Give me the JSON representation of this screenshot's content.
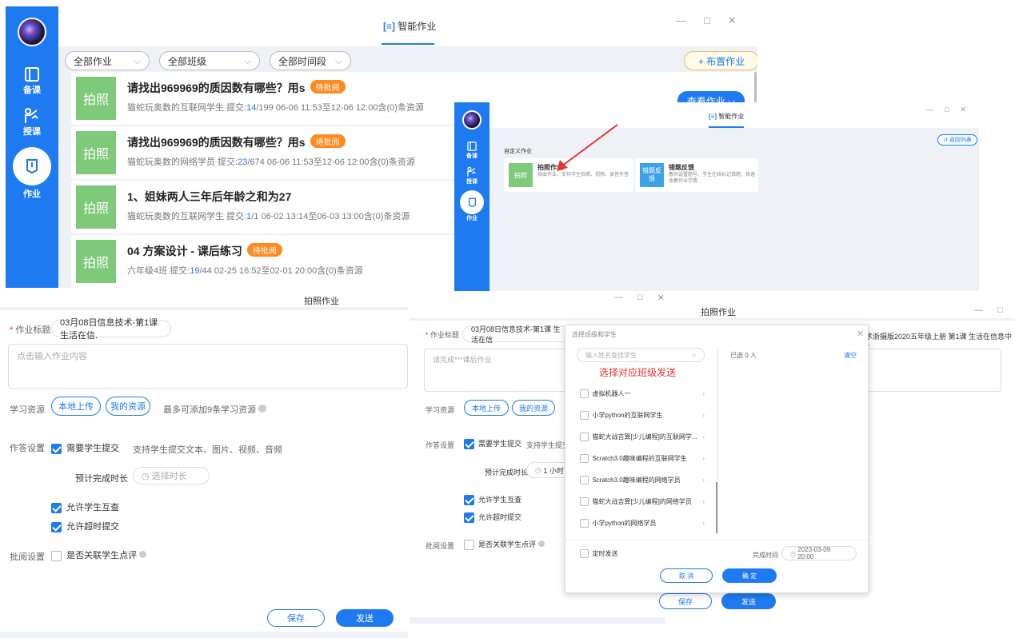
{
  "list": {
    "title": "智能作业",
    "filters": [
      "全部作业",
      "全部班级",
      "全部时间段"
    ],
    "add_label": "+ 布置作业",
    "view_label": "查看作业",
    "nav": [
      "备课",
      "授课",
      "作业"
    ],
    "thumb_label": "拍照",
    "cards": [
      {
        "title": "请找出969969的质因数有哪些？用s",
        "tag": "待批阅",
        "sub_a": "猫蛇玩奥数的互联网学生  提交:",
        "sub_n": "14",
        "sub_b": "/199   06-06 11:53至12-06 12:00含(0)条资源"
      },
      {
        "title": "请找出969969的质因数有哪些？用s",
        "tag": "待批阅",
        "sub_a": "猫蛇玩奥数的网络学员   提交:",
        "sub_n": "23",
        "sub_b": "/674   06-06 11:53至12-06 12:00含(0)条资源"
      },
      {
        "title": "1、姐妹两人三年后年龄之和为27",
        "tag": "",
        "sub_a": "猫蛇玩奥数的互联网学生  提交:",
        "sub_n": "1",
        "sub_b": "/1   06-02 13:14至06-03 13:00含(0)条资源"
      },
      {
        "title": "04 方案设计 - 课后练习",
        "tag": "待批阅",
        "sub_a": "六年级4班  提交:",
        "sub_n": "19",
        "sub_b": "/44   02-25 16:52至02-01 20:00含(0)条资源"
      }
    ]
  },
  "picker": {
    "title": "智能作业",
    "section": "自定义作业",
    "back": "返回列表",
    "nav": [
      "备课",
      "授课",
      "作业"
    ],
    "opt1": {
      "thumb": "拍照",
      "title": "拍照作业",
      "desc": "自由作业，支持学生拍照、视频、录音作答"
    },
    "opt2": {
      "thumb": "错题反馈",
      "title": "错题反馈",
      "desc": "教师设置题号，学生在线标记错题，快速收集作业学情"
    }
  },
  "form1": {
    "title": "拍照作业",
    "title_label": "作业标题",
    "title_value": "03月08日信息技术-第1课 生活在信.",
    "content_placeholder": "点击输入作业内容",
    "res_label": "学习资源",
    "local_upload": "本地上传",
    "my_res": "我的资源",
    "res_hint": "最多可添加9条学习资源",
    "set_label": "作答设置",
    "need_submit": "需要学生提交",
    "need_hint": "支持学生提交文本、图片、视频、音频",
    "est_label": "预计完成时长",
    "est_placeholder": "选择时长",
    "mutual": "允许学生互查",
    "overtime": "允许超时提交",
    "review_label": "批阅设置",
    "review_opt": "是否关联学生点评",
    "save": "保存",
    "send": "发送"
  },
  "form2": {
    "title": "拍照作业",
    "title_label": "作业标题",
    "title_value": "03月08日信息技术-第1课 生活在信",
    "crumb": "术浙摄版2020五年级上册  第1课 生活在信息中 >",
    "content_placeholder": "请完成***课后作业",
    "res_label": "学习资源",
    "local_upload": "本地上传",
    "my_res": "我的资源",
    "set_label": "作答设置",
    "need_submit": "需要学生提交",
    "need_hint": "支持学生提交",
    "est_label": "预计完成时长",
    "est_value": "1 小时",
    "mutual": "允许学生互查",
    "overtime": "允许超时提交",
    "review_label": "批阅设置",
    "review_opt": "是否关联学生点评",
    "save": "保存",
    "send": "发送"
  },
  "dialog": {
    "title": "选择班级和学生",
    "search_placeholder": "输入姓名查找学生",
    "selected": "已选 0 人",
    "clear": "清空",
    "annotation": "选择对应班级发送",
    "classes": [
      "虚拟机器人一",
      "小学python的互联网学生",
      "猫蛇大战吉算[少儿编程]的互联网学...",
      "Scratch3.0趣味编程的互联网学生",
      "Scratch3.0趣味编程的网络学员",
      "猫蛇大战吉算[少儿编程]的网络学员",
      "小学python的网络学员"
    ],
    "timed": "定时发送",
    "finish_label": "完成时间",
    "finish_value": "2023-03-09 20:00",
    "cancel": "取 消",
    "ok": "确 定"
  },
  "colors": {
    "primary": "#1e7af0",
    "tag": "#ff8a1f",
    "thumb": "#7ec97a",
    "annotation": "#e8332c"
  }
}
